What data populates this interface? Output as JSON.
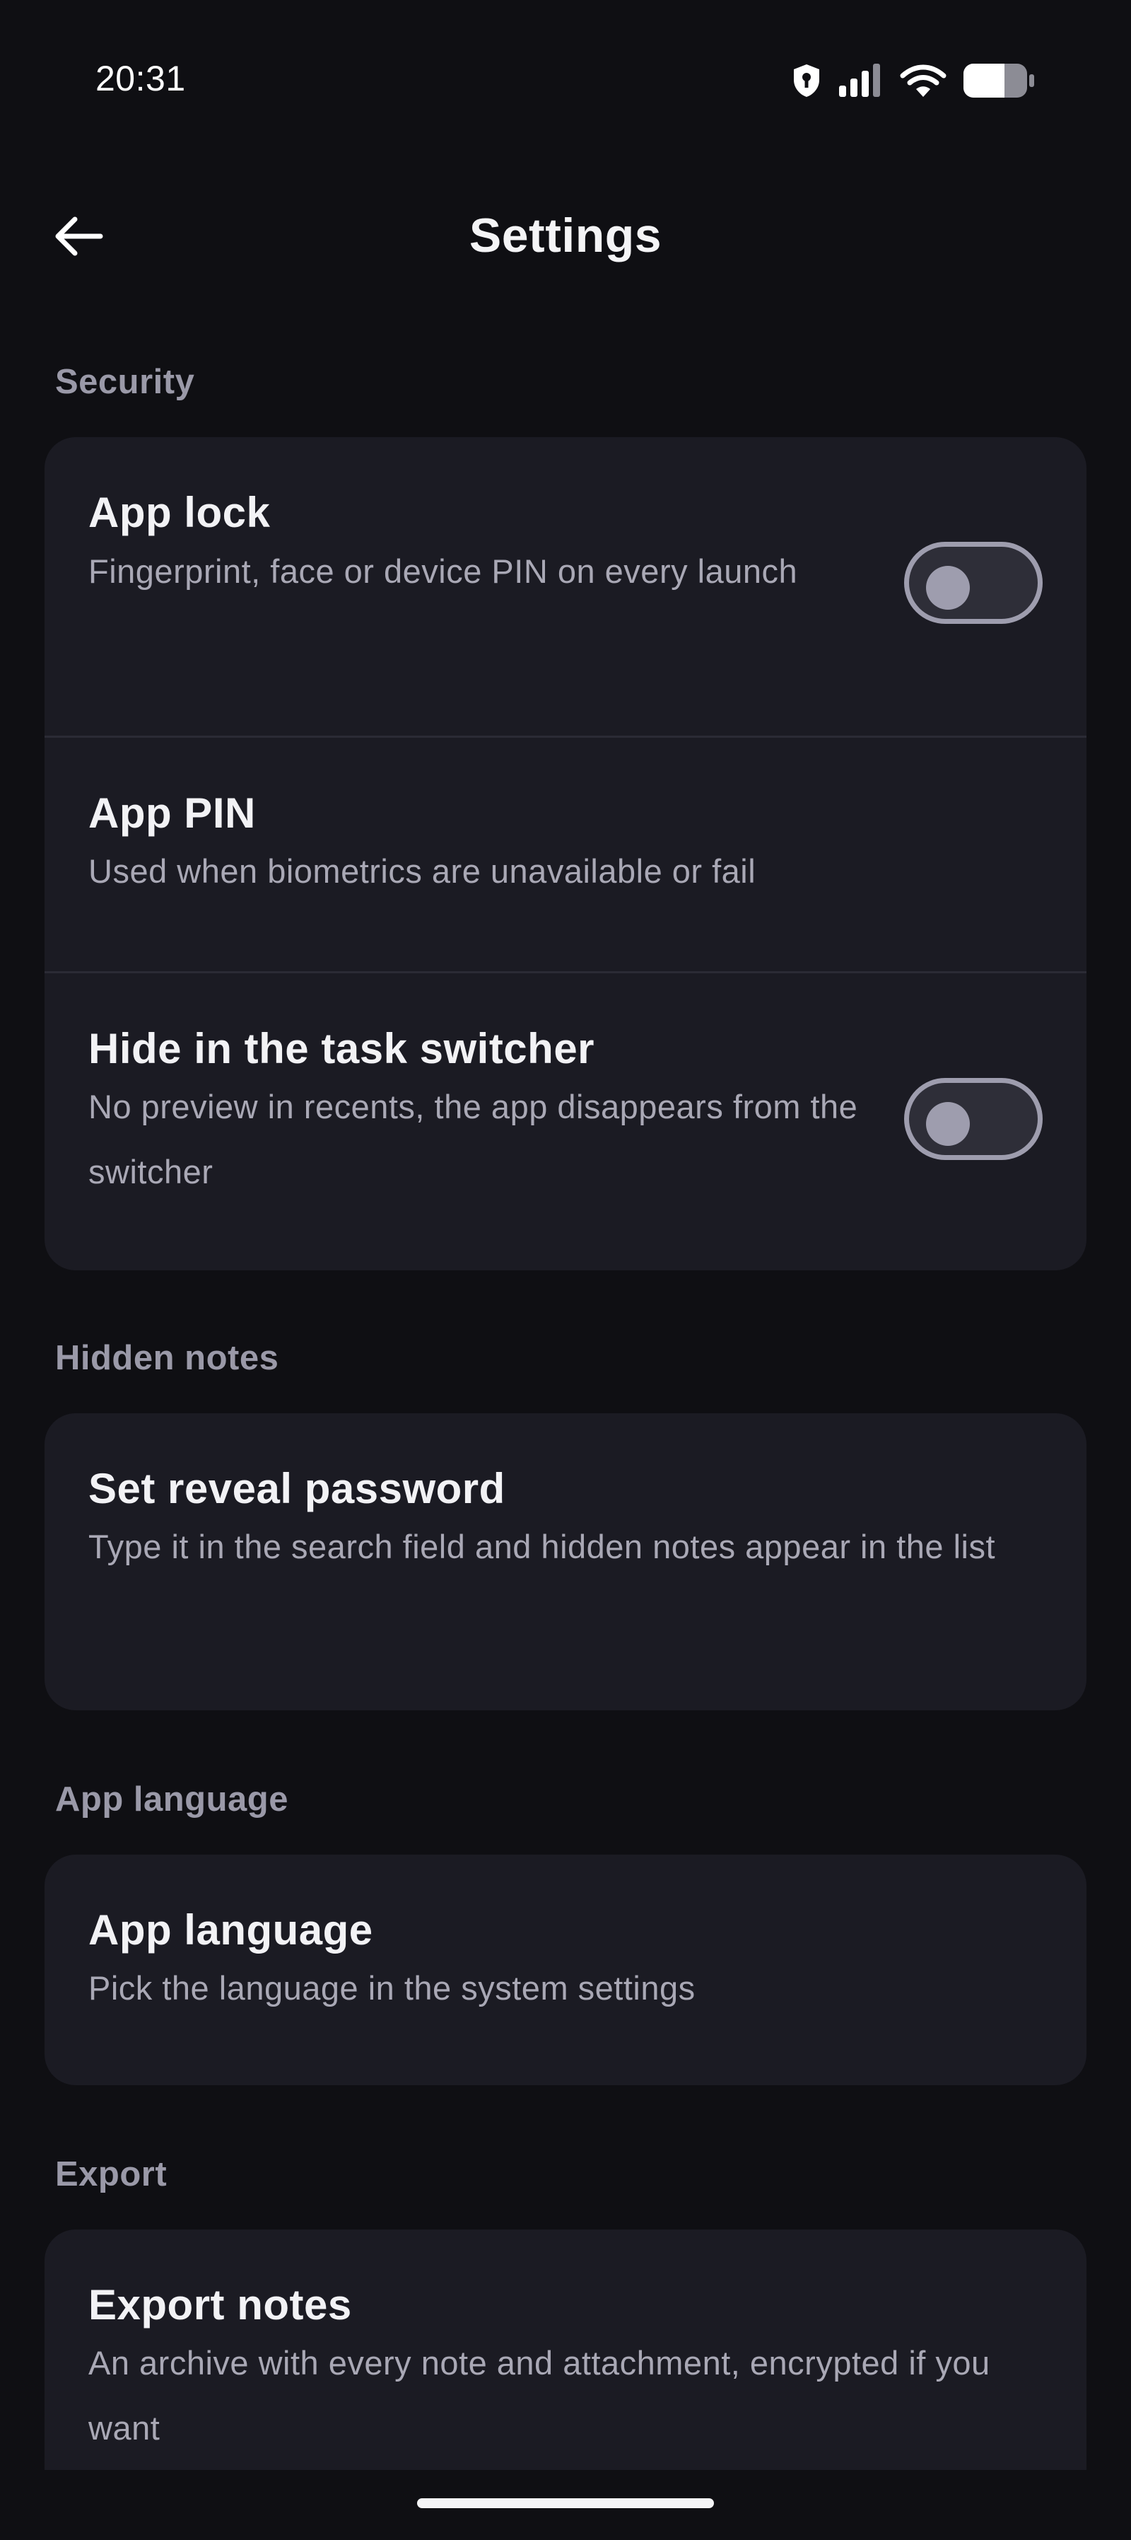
{
  "status_bar": {
    "time": "20:31"
  },
  "app_bar": {
    "title": "Settings"
  },
  "sections": {
    "security": {
      "header": "Security",
      "app_lock": {
        "title": "App lock",
        "subtitle": "Fingerprint, face or device PIN on every launch",
        "enabled": false
      },
      "app_pin": {
        "title": "App PIN",
        "subtitle": "Used when biometrics are unavailable or fail"
      },
      "hide_switcher": {
        "title": "Hide in the task switcher",
        "subtitle": "No preview in recents, the app disappears from the switcher",
        "enabled": false
      }
    },
    "hidden_notes": {
      "header": "Hidden notes",
      "reveal_password": {
        "title": "Set reveal password",
        "subtitle": "Type it in the search field and hidden notes appear in the list"
      }
    },
    "app_language": {
      "header": "App language",
      "language": {
        "title": "App language",
        "subtitle": "Pick the language in the system settings"
      }
    },
    "export": {
      "header": "Export",
      "export_notes": {
        "title": "Export notes",
        "subtitle": "An archive with every note and attachment, encrypted if you want"
      }
    }
  },
  "icons": {
    "back": "arrow-left-icon",
    "vpn": "shield-key-icon",
    "signal": "signal-icon",
    "wifi": "wifi-icon",
    "battery": "battery-icon"
  },
  "colors": {
    "background": "#0f0f13",
    "card": "#1b1b23",
    "section_header": "#9a99a8",
    "toggle_off": "#9e9dae"
  }
}
